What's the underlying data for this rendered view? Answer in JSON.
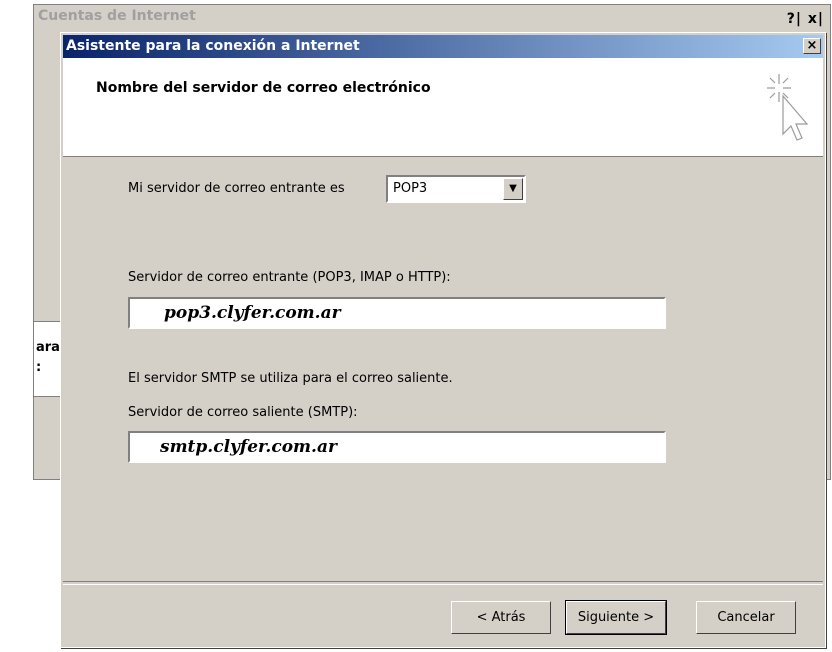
{
  "background_window": {
    "title": "Cuentas de Internet",
    "title_buttons": "?| x|",
    "fragment_text": [
      "ara",
      ":"
    ]
  },
  "dialog": {
    "title": "Asistente para la conexión a Internet",
    "close_label": "×",
    "header_title": "Nombre del servidor de correo electrónico",
    "header_icon": "wizard-cursor-sparkle-icon"
  },
  "form": {
    "incoming_type_label": "Mi servidor de correo entrante es",
    "incoming_type_value": "POP3",
    "dropdown_arrow": "▼",
    "incoming_server_label": "Servidor de correo entrante (POP3, IMAP o HTTP):",
    "incoming_server_value": "pop3.clyfer.com.ar",
    "smtp_note": "El servidor SMTP se utiliza para el correo saliente.",
    "outgoing_server_label": "Servidor de correo saliente (SMTP):",
    "outgoing_server_value": "smtp.clyfer.com.ar"
  },
  "buttons": {
    "back": "< Atrás",
    "next": "Siguiente >",
    "cancel": "Cancelar"
  },
  "colors": {
    "titlebar_start": "#0a246a",
    "titlebar_end": "#a6caf0",
    "dialog_face": "#d4d0c8"
  }
}
